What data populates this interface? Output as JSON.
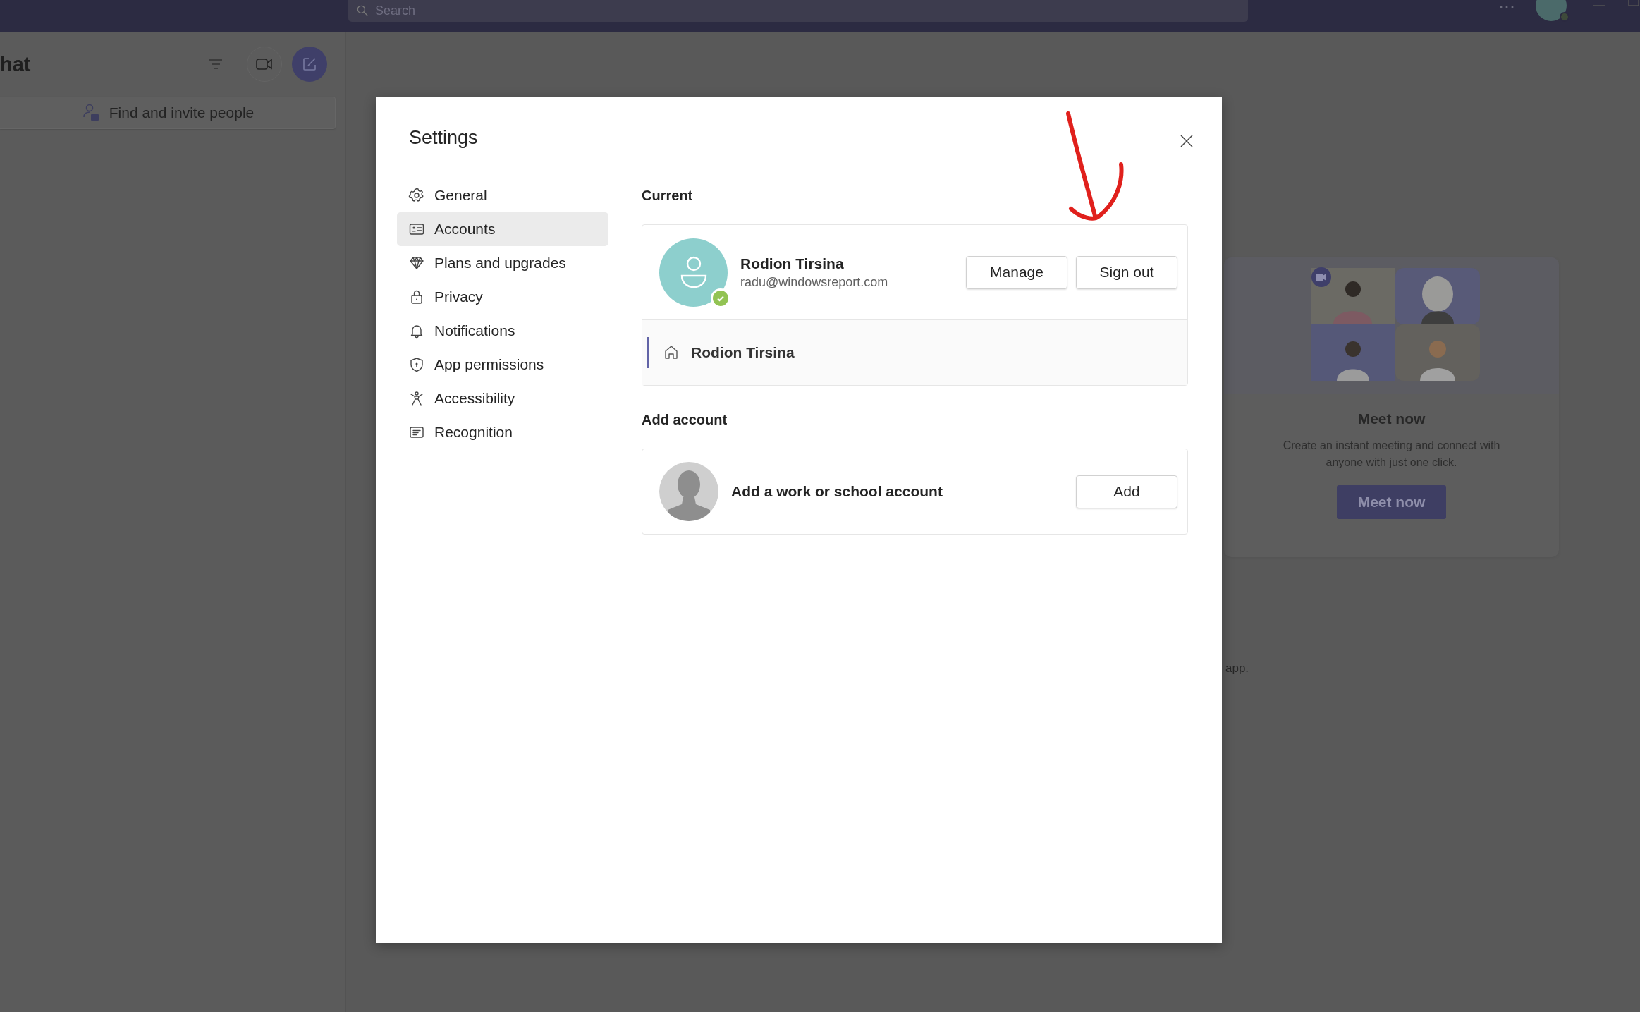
{
  "top_bar": {
    "search": {
      "placeholder": "Search"
    }
  },
  "chat_panel": {
    "title": "hat",
    "find_people": "Find and invite people"
  },
  "meet_card": {
    "title": "Meet now",
    "description": "Create an instant meeting and connect with anyone with just one click.",
    "button": "Meet now"
  },
  "background_fragment": "app.",
  "settings": {
    "title": "Settings",
    "nav": [
      {
        "label": "General",
        "kind": "gear",
        "selected": false
      },
      {
        "label": "Accounts",
        "kind": "id-card",
        "selected": true
      },
      {
        "label": "Plans and upgrades",
        "kind": "diamond",
        "selected": false
      },
      {
        "label": "Privacy",
        "kind": "lock",
        "selected": false
      },
      {
        "label": "Notifications",
        "kind": "bell",
        "selected": false
      },
      {
        "label": "App permissions",
        "kind": "shield",
        "selected": false
      },
      {
        "label": "Accessibility",
        "kind": "figure",
        "selected": false
      },
      {
        "label": "Recognition",
        "kind": "note",
        "selected": false
      }
    ],
    "current": {
      "heading": "Current",
      "account": {
        "name": "Rodion Tirsina",
        "email": "radu@windowsreport.com",
        "verified": true,
        "buttons": [
          "Manage",
          "Sign out"
        ]
      },
      "org": {
        "name": "Rodion Tirsina"
      }
    },
    "add_account": {
      "heading": "Add account",
      "label": "Add a work or school account",
      "button": "Add"
    }
  }
}
